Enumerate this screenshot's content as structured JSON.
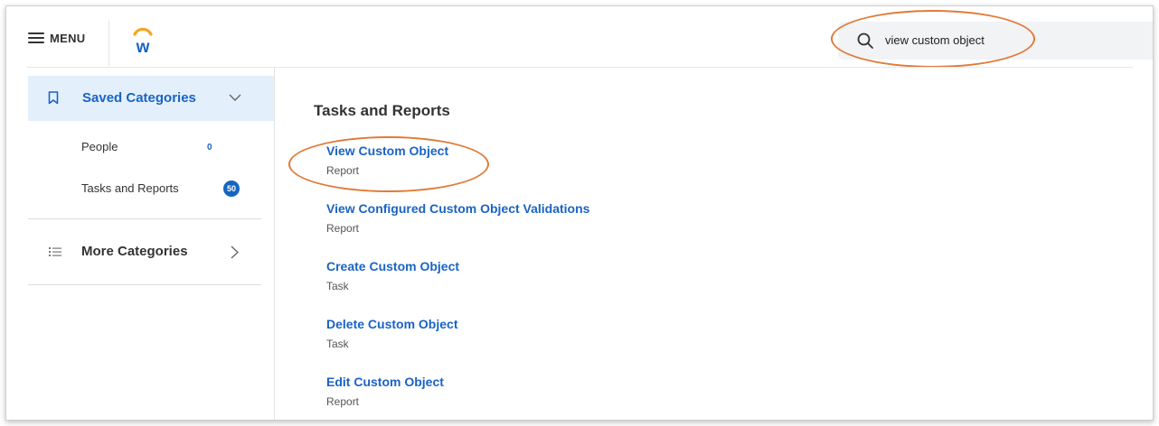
{
  "header": {
    "menu_label": "MENU",
    "logo_icon": "workday-logo",
    "search": {
      "value": "view custom object",
      "icon": "search-icon"
    }
  },
  "sidebar": {
    "saved_categories": {
      "label": "Saved Categories",
      "icon": "bookmark-icon"
    },
    "items": [
      {
        "label": "People",
        "count": "0"
      },
      {
        "label": "Tasks and Reports",
        "count": "50"
      }
    ],
    "more_categories": {
      "label": "More Categories",
      "icon": "list-icon"
    }
  },
  "main": {
    "section_title": "Tasks and Reports",
    "results": [
      {
        "title": "View Custom Object",
        "type": "Report"
      },
      {
        "title": "View Configured Custom Object Validations",
        "type": "Report"
      },
      {
        "title": "Create Custom Object",
        "type": "Task"
      },
      {
        "title": "Delete Custom Object",
        "type": "Task"
      },
      {
        "title": "Edit Custom Object",
        "type": "Report"
      }
    ]
  },
  "colors": {
    "accent": "#1a63c4",
    "annotation": "#e07b39",
    "selected_bg": "#e3f0fb",
    "logo_orange": "#f5a623"
  }
}
